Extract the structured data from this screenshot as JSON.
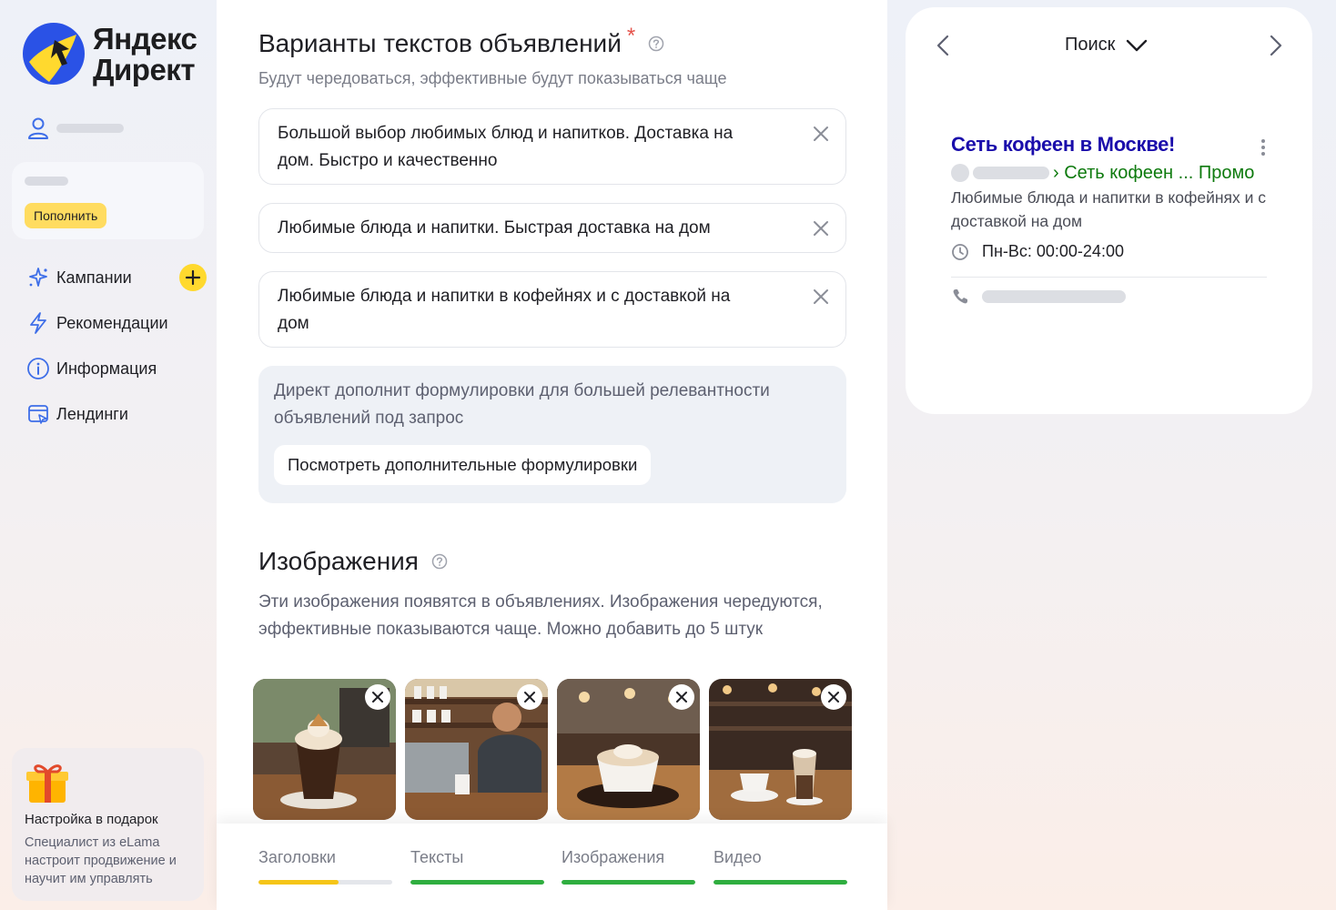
{
  "brand": {
    "line1": "Яндекс",
    "line2": "Директ",
    "accent": "#ffdc60",
    "blue": "#2a52e6"
  },
  "sidebar": {
    "topup_label": "Пополнить",
    "items": [
      {
        "label": "Кампании",
        "icon": "sparkle-icon"
      },
      {
        "label": "Рекомендации",
        "icon": "lightning-icon"
      },
      {
        "label": "Информация",
        "icon": "info-icon"
      },
      {
        "label": "Лендинги",
        "icon": "landing-icon"
      }
    ],
    "promo": {
      "title": "Настройка в подарок",
      "description": "Специалист из eLama настроит продвижение и научит им управлять"
    }
  },
  "texts_section": {
    "title": "Варианты текстов объявлений",
    "required_mark": "*",
    "subtitle": "Будут чередоваться, эффективные будут показываться чаще",
    "items": [
      "Большой выбор любимых блюд и напитков. Доставка на дом. Быстро и качественно",
      "Любимые блюда и напитки. Быстрая доставка на дом",
      "Любимые блюда и напитки в кофейнях и с доставкой на дом"
    ],
    "info": "Директ дополнит формулировки для большей релевантности объявлений под запрос",
    "more_button": "Посмотреть дополнительные формулировки"
  },
  "images_section": {
    "title": "Изображения",
    "description": "Эти изображения появятся в объявлениях. Изображения чередуются, эффективные показываются чаще. Можно добавить до 5 штук"
  },
  "progress_tabs": [
    {
      "label": "Заголовки",
      "progress": 0.6,
      "color": "#f5c518"
    },
    {
      "label": "Тексты",
      "progress": 1.0,
      "color": "#2fae3f"
    },
    {
      "label": "Изображения",
      "progress": 1.0,
      "color": "#2fae3f"
    },
    {
      "label": "Видео",
      "progress": 1.0,
      "color": "#2fae3f"
    }
  ],
  "preview": {
    "mode": "Поиск",
    "ad": {
      "title": "Сеть кофеен в Москве!",
      "breadcrumb": "› Сеть кофеен ... Промо",
      "description": "Любимые блюда и напитки в кофейнях и с доставкой на дом",
      "hours": "Пн-Вс: 00:00-24:00"
    }
  }
}
